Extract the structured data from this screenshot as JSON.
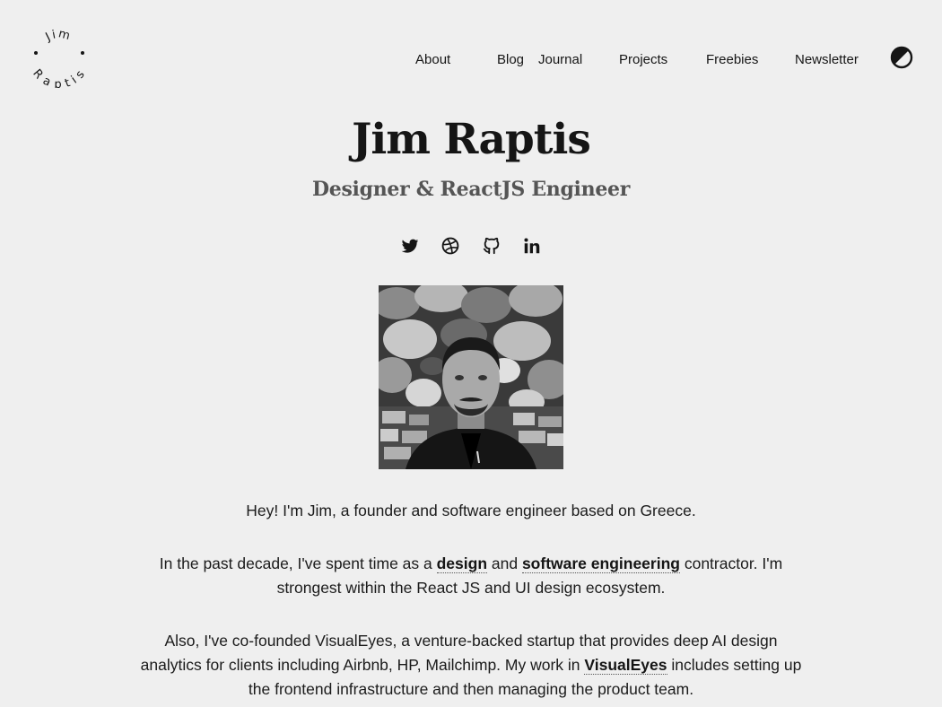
{
  "brand": {
    "logo_text_top": "Jim",
    "logo_text_bottom": "Raptis",
    "logo_icon": "circular-text-logo"
  },
  "nav": {
    "items": [
      "About",
      "Blog",
      "Journal",
      "Projects",
      "Freebies",
      "Newsletter"
    ],
    "theme_toggle_icon": "half-circle-contrast-icon"
  },
  "hero": {
    "name": "Jim Raptis",
    "tagline": "Designer & ReactJS Engineer"
  },
  "socials": [
    {
      "icon": "twitter-icon"
    },
    {
      "icon": "dribbble-icon"
    },
    {
      "icon": "github-icon"
    },
    {
      "icon": "linkedin-icon"
    }
  ],
  "bio": {
    "p1": "Hey! I'm Jim, a founder and software engineer based on Greece.",
    "p2": {
      "a": "In the past decade, I've spent time as a ",
      "link1": "design",
      "b": " and ",
      "link2": "software engineering",
      "c": " contractor. I'm strongest within the React JS and UI design ecosystem."
    },
    "p3": {
      "a": "Also, I've co-founded VisualEyes, a venture-backed startup that provides deep AI design analytics for clients including Airbnb, HP, Mailchimp. My work in ",
      "link": "VisualEyes",
      "b": " includes setting up the frontend infrastructure and then managing the product team."
    }
  },
  "colors": {
    "background": "#efefef",
    "text": "#151515",
    "subtitle": "#555555"
  }
}
